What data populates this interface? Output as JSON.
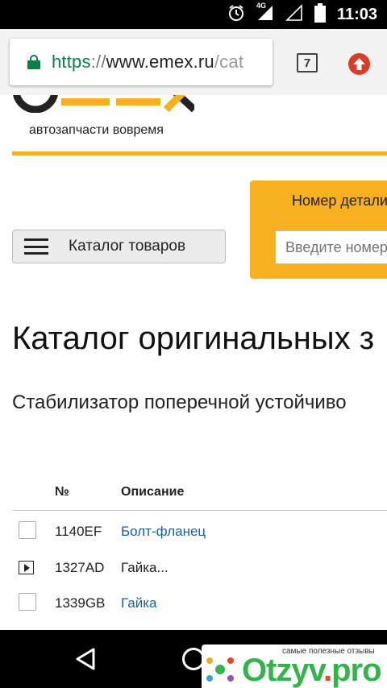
{
  "status_bar": {
    "time": "11:03",
    "network_label": "4G",
    "icons": [
      "alarm-icon",
      "signal-icon",
      "battery-icon"
    ]
  },
  "browser": {
    "url": {
      "scheme": "https",
      "separator": "://",
      "host": "www.emex.ru",
      "path": "/cat"
    },
    "tab_count": "7",
    "update_icon": "update-arrow-icon"
  },
  "site": {
    "logo_text": "EMEX",
    "tagline": "автозапчасти вовремя",
    "brand_color": "#f9b020"
  },
  "search": {
    "label": "Номер детали",
    "placeholder": "Введите номер"
  },
  "catalog_button": {
    "label": "Каталог товаров"
  },
  "heading": "Каталог оригинальных з",
  "subheading": "Стабилизатор поперечной устойчиво",
  "table": {
    "headers": {
      "no": "№",
      "description": "Описание"
    },
    "rows": [
      {
        "control": "checkbox",
        "no": "1140EF",
        "description": "Болт-фланец",
        "link": true
      },
      {
        "control": "expand",
        "no": "1327AD",
        "description": "Гайка...",
        "link": false
      },
      {
        "control": "checkbox",
        "no": "1339GB",
        "description": "Гайка",
        "link": true
      }
    ]
  },
  "watermark": {
    "caption": "самые полезные отзывы",
    "name": "Otzyv",
    "dot": ".",
    "tld": "pro"
  }
}
